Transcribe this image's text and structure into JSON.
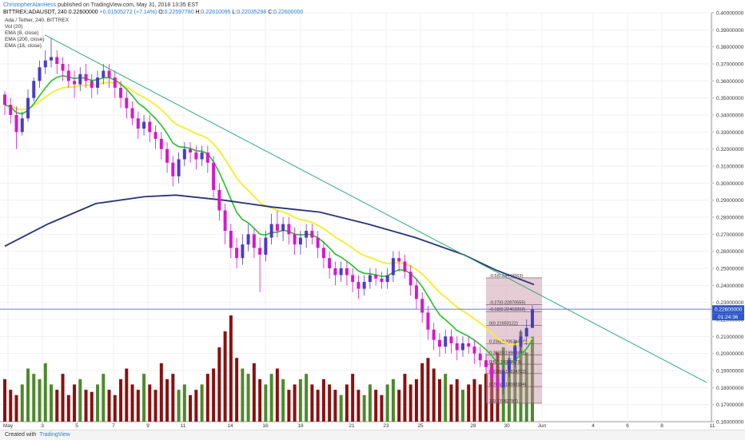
{
  "header": {
    "author": "ChristopherAlanHess",
    "published": "published on TradingView.com, May 31, 2018 13:35 EST",
    "symbol": "BITTREX:ADAUSDT, 240",
    "price": "0.22600000",
    "change": "+0.01505272 (+7.14%)",
    "o_label": "O:",
    "o_value": "0.22597780",
    "h_label": "H:",
    "h_value": "0.22810095",
    "l_label": "L:",
    "l_value": "0.22035298",
    "c_label": "C:",
    "c_value": "0.22600000"
  },
  "legend": {
    "title": "Ada / Tether, 240, BITTREX",
    "vol": "Vol (20)",
    "ema8": "EMA (8, close)",
    "ema200": "EMA (200, close)",
    "ema18": "EMA (18, close)"
  },
  "footer": {
    "created_with": "Created with",
    "brand": "TradingView"
  },
  "chart_data": {
    "type": "candlestick",
    "price_axis": [
      "0.40000000",
      "0.39000000",
      "0.38000000",
      "0.37000000",
      "0.36000000",
      "0.35000000",
      "0.34000000",
      "0.33000000",
      "0.32000000",
      "0.31000000",
      "0.30000000",
      "0.29000000",
      "0.28000000",
      "0.27000000",
      "0.26000000",
      "0.25000000",
      "0.24000000",
      "0.23000000",
      "0.22000000",
      "0.21000000",
      "0.20000000",
      "0.19000000",
      "0.18000000",
      "0.17000000",
      "0.16000000"
    ],
    "y_range": [
      0.16,
      0.4
    ],
    "current_price_label": "0.22600000",
    "countdown_label": "01:24:36",
    "time_axis": [
      "May",
      "3",
      "5",
      "7",
      "9",
      "11",
      "14",
      "16",
      "18",
      "21",
      "23",
      "25",
      "28",
      "30",
      "Jun",
      "4",
      "6",
      "8",
      "11"
    ],
    "fib_levels": [
      {
        "label": "-0.5(0.24443563)",
        "value": 0.2444
      },
      {
        "label": "-0.27(0.22870555)",
        "value": 0.2287
      },
      {
        "label": "-0.18(0.22463392)",
        "value": 0.2246
      },
      {
        "label": "0(0.21650122)",
        "value": 0.2165
      },
      {
        "label": "0.236(0.20574424)",
        "value": 0.2057
      },
      {
        "label": "0.382(0.19908471)",
        "value": 0.1991
      },
      {
        "label": "0.5(0.19366671)",
        "value": 0.1937
      },
      {
        "label": "0.618(0.18824722)",
        "value": 0.1882
      },
      {
        "label": "0.786(0.18063194)",
        "value": 0.1806
      },
      {
        "label": "1(0.17082787)",
        "value": 0.1708
      }
    ],
    "candles": [
      [
        0.352,
        0.346,
        0.354,
        0.34
      ],
      [
        0.346,
        0.34,
        0.35,
        0.335
      ],
      [
        0.34,
        0.33,
        0.345,
        0.32
      ],
      [
        0.33,
        0.338,
        0.342,
        0.328
      ],
      [
        0.338,
        0.35,
        0.355,
        0.336
      ],
      [
        0.35,
        0.36,
        0.362,
        0.348
      ],
      [
        0.36,
        0.368,
        0.372,
        0.356
      ],
      [
        0.368,
        0.372,
        0.378,
        0.364
      ],
      [
        0.372,
        0.374,
        0.385,
        0.368
      ],
      [
        0.374,
        0.37,
        0.378,
        0.364
      ],
      [
        0.37,
        0.366,
        0.374,
        0.36
      ],
      [
        0.366,
        0.36,
        0.37,
        0.356
      ],
      [
        0.36,
        0.358,
        0.366,
        0.35
      ],
      [
        0.358,
        0.364,
        0.368,
        0.354
      ],
      [
        0.364,
        0.36,
        0.37,
        0.356
      ],
      [
        0.36,
        0.356,
        0.364,
        0.35
      ],
      [
        0.356,
        0.362,
        0.366,
        0.352
      ],
      [
        0.362,
        0.366,
        0.37,
        0.358
      ],
      [
        0.366,
        0.362,
        0.37,
        0.356
      ],
      [
        0.362,
        0.356,
        0.366,
        0.35
      ],
      [
        0.356,
        0.35,
        0.36,
        0.344
      ],
      [
        0.35,
        0.344,
        0.354,
        0.338
      ],
      [
        0.344,
        0.338,
        0.348,
        0.334
      ],
      [
        0.338,
        0.332,
        0.342,
        0.326
      ],
      [
        0.332,
        0.336,
        0.34,
        0.328
      ],
      [
        0.336,
        0.33,
        0.34,
        0.324
      ],
      [
        0.33,
        0.326,
        0.334,
        0.32
      ],
      [
        0.326,
        0.32,
        0.33,
        0.314
      ],
      [
        0.32,
        0.312,
        0.324,
        0.306
      ],
      [
        0.312,
        0.304,
        0.316,
        0.298
      ],
      [
        0.304,
        0.314,
        0.318,
        0.3
      ],
      [
        0.314,
        0.32,
        0.324,
        0.31
      ],
      [
        0.32,
        0.318,
        0.324,
        0.312
      ],
      [
        0.318,
        0.314,
        0.322,
        0.308
      ],
      [
        0.314,
        0.318,
        0.322,
        0.31
      ],
      [
        0.318,
        0.312,
        0.322,
        0.306
      ],
      [
        0.312,
        0.296,
        0.316,
        0.29
      ],
      [
        0.296,
        0.284,
        0.3,
        0.278
      ],
      [
        0.284,
        0.272,
        0.288,
        0.264
      ],
      [
        0.272,
        0.262,
        0.276,
        0.256
      ],
      [
        0.262,
        0.256,
        0.268,
        0.25
      ],
      [
        0.256,
        0.264,
        0.27,
        0.252
      ],
      [
        0.264,
        0.27,
        0.276,
        0.26
      ],
      [
        0.27,
        0.262,
        0.274,
        0.256
      ],
      [
        0.262,
        0.258,
        0.268,
        0.236
      ],
      [
        0.258,
        0.268,
        0.272,
        0.254
      ],
      [
        0.268,
        0.276,
        0.282,
        0.264
      ],
      [
        0.276,
        0.272,
        0.284,
        0.268
      ],
      [
        0.272,
        0.276,
        0.28,
        0.266
      ],
      [
        0.276,
        0.27,
        0.28,
        0.264
      ],
      [
        0.27,
        0.264,
        0.274,
        0.258
      ],
      [
        0.264,
        0.268,
        0.272,
        0.258
      ],
      [
        0.268,
        0.272,
        0.276,
        0.262
      ],
      [
        0.272,
        0.268,
        0.276,
        0.264
      ],
      [
        0.268,
        0.262,
        0.272,
        0.256
      ],
      [
        0.262,
        0.256,
        0.266,
        0.25
      ],
      [
        0.256,
        0.25,
        0.26,
        0.244
      ],
      [
        0.25,
        0.246,
        0.254,
        0.24
      ],
      [
        0.246,
        0.25,
        0.254,
        0.242
      ],
      [
        0.25,
        0.246,
        0.254,
        0.24
      ],
      [
        0.246,
        0.242,
        0.25,
        0.236
      ],
      [
        0.242,
        0.238,
        0.246,
        0.232
      ],
      [
        0.238,
        0.242,
        0.246,
        0.234
      ],
      [
        0.242,
        0.246,
        0.25,
        0.238
      ],
      [
        0.246,
        0.244,
        0.25,
        0.24
      ],
      [
        0.244,
        0.242,
        0.248,
        0.238
      ],
      [
        0.242,
        0.246,
        0.25,
        0.238
      ],
      [
        0.246,
        0.256,
        0.26,
        0.242
      ],
      [
        0.256,
        0.254,
        0.26,
        0.248
      ],
      [
        0.254,
        0.248,
        0.258,
        0.244
      ],
      [
        0.248,
        0.24,
        0.252,
        0.234
      ],
      [
        0.24,
        0.232,
        0.244,
        0.226
      ],
      [
        0.232,
        0.224,
        0.236,
        0.218
      ],
      [
        0.224,
        0.214,
        0.228,
        0.208
      ],
      [
        0.214,
        0.208,
        0.218,
        0.202
      ],
      [
        0.208,
        0.204,
        0.212,
        0.198
      ],
      [
        0.204,
        0.21,
        0.214,
        0.2
      ],
      [
        0.21,
        0.206,
        0.214,
        0.2
      ],
      [
        0.206,
        0.202,
        0.21,
        0.196
      ],
      [
        0.202,
        0.206,
        0.21,
        0.198
      ],
      [
        0.206,
        0.204,
        0.21,
        0.2
      ],
      [
        0.204,
        0.2,
        0.208,
        0.194
      ],
      [
        0.2,
        0.196,
        0.204,
        0.192
      ],
      [
        0.196,
        0.192,
        0.2,
        0.188
      ],
      [
        0.192,
        0.186,
        0.196,
        0.18
      ],
      [
        0.186,
        0.18,
        0.19,
        0.174
      ],
      [
        0.18,
        0.19,
        0.194,
        0.176
      ],
      [
        0.19,
        0.196,
        0.2,
        0.186
      ],
      [
        0.196,
        0.204,
        0.208,
        0.192
      ],
      [
        0.204,
        0.21,
        0.214,
        0.2
      ],
      [
        0.21,
        0.215,
        0.22,
        0.205
      ],
      [
        0.215,
        0.226,
        0.2281,
        0.2204
      ]
    ],
    "volume": [
      0.4,
      0.3,
      0.25,
      0.35,
      0.5,
      0.45,
      0.4,
      0.55,
      0.35,
      0.3,
      0.45,
      0.25,
      0.35,
      0.4,
      0.3,
      0.28,
      0.35,
      0.45,
      0.3,
      0.25,
      0.4,
      0.5,
      0.35,
      0.3,
      0.45,
      0.35,
      0.3,
      0.55,
      0.4,
      0.45,
      0.3,
      0.35,
      0.25,
      0.3,
      0.35,
      0.45,
      0.5,
      0.7,
      0.85,
      1.0,
      0.6,
      0.5,
      0.45,
      0.55,
      0.4,
      0.35,
      0.45,
      0.5,
      0.4,
      0.3,
      0.35,
      0.4,
      0.45,
      0.35,
      0.3,
      0.4,
      0.35,
      0.3,
      0.25,
      0.35,
      0.45,
      0.3,
      0.25,
      0.35,
      0.3,
      0.25,
      0.35,
      0.4,
      0.3,
      0.45,
      0.35,
      0.4,
      0.55,
      0.6,
      0.5,
      0.4,
      0.45,
      0.35,
      0.4,
      0.3,
      0.35,
      0.4,
      0.35,
      0.45,
      0.55,
      0.65,
      0.7,
      0.6,
      0.75,
      0.85,
      0.65,
      0.8
    ],
    "vol_colors": {
      "up": "#4c8a2b",
      "down": "#8b0f0f"
    },
    "candle_colors": {
      "up": "#4b3cc4",
      "down": "#d617cf"
    },
    "ema_colors": {
      "ema8": "#22c02a",
      "ema18": "#f5ee3a",
      "ema200": "#27347a"
    },
    "trendline": {
      "color": "#2eaa7e",
      "from": [
        0.0,
        0.387
      ],
      "to": [
        1.0,
        0.181
      ]
    },
    "hline": {
      "value": 0.226,
      "color": "#5a6ad8"
    }
  }
}
